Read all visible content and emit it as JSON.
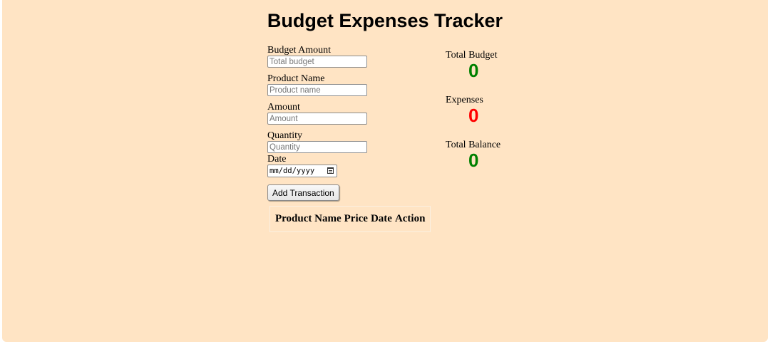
{
  "title": "Budget Expenses Tracker",
  "form": {
    "budget": {
      "label": "Budget Amount",
      "placeholder": "Total budget"
    },
    "product": {
      "label": "Product Name",
      "placeholder": "Product name"
    },
    "amount": {
      "label": "Amount",
      "placeholder": "Amount"
    },
    "quantity": {
      "label": "Quantity",
      "placeholder": "Quantity"
    },
    "date": {
      "label": "Date",
      "placeholder": "mm/dd/yyyy"
    },
    "add_button": "Add Transaction"
  },
  "table": {
    "headers": [
      "Product Name",
      "Price",
      "Date",
      "Action"
    ]
  },
  "summary": {
    "total_budget": {
      "label": "Total Budget",
      "value": "0",
      "color": "#008000"
    },
    "expenses": {
      "label": "Expenses",
      "value": "0",
      "color": "#ff0000"
    },
    "total_balance": {
      "label": "Total Balance",
      "value": "0",
      "color": "#008000"
    }
  },
  "colors": {
    "background": "#ffe4c4"
  }
}
